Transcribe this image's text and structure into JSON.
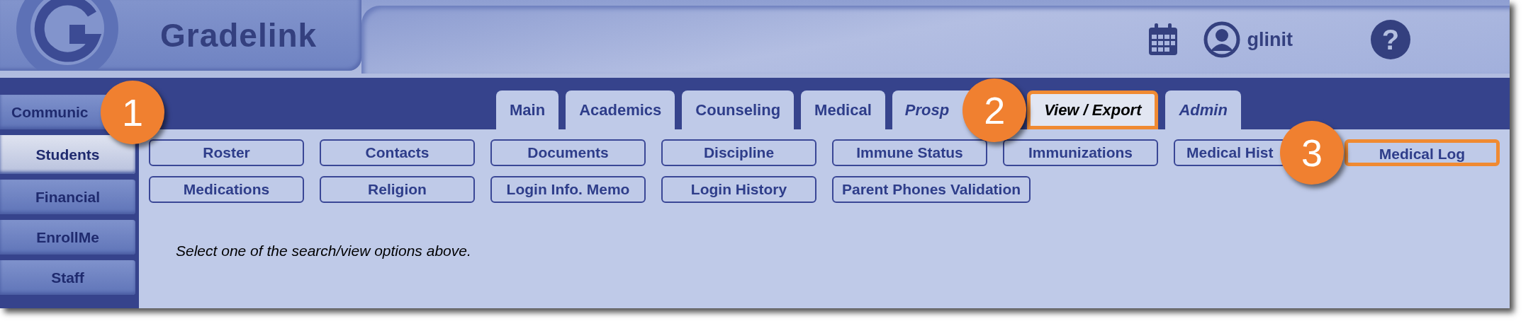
{
  "header": {
    "brand": "Gradelink",
    "username": "glinit",
    "help": "?"
  },
  "sidebar": {
    "items": [
      {
        "label": "Communic",
        "selected": false,
        "cut": true
      },
      {
        "label": "Students",
        "selected": true,
        "cut": false
      },
      {
        "label": "Financial",
        "selected": false,
        "cut": false
      },
      {
        "label": "EnrollMe",
        "selected": false,
        "cut": false
      },
      {
        "label": "Staff",
        "selected": false,
        "cut": false
      }
    ]
  },
  "tabs": [
    {
      "label": "Main",
      "kind": "standard",
      "selected": false,
      "highlighted": false,
      "cut": false
    },
    {
      "label": "Academics",
      "kind": "standard",
      "selected": false,
      "highlighted": false,
      "cut": false
    },
    {
      "label": "Counseling",
      "kind": "standard",
      "selected": false,
      "highlighted": false,
      "cut": false
    },
    {
      "label": "Medical",
      "kind": "standard",
      "selected": false,
      "highlighted": false,
      "cut": false
    },
    {
      "label": "Prosp",
      "kind": "extra",
      "selected": false,
      "highlighted": false,
      "cut": true
    },
    {
      "label": "View / Export",
      "kind": "extra",
      "selected": true,
      "highlighted": true,
      "cut": false
    },
    {
      "label": "Admin",
      "kind": "extra",
      "selected": false,
      "highlighted": false,
      "cut": false
    }
  ],
  "options": [
    {
      "label": "Roster",
      "highlighted": false,
      "cut": false
    },
    {
      "label": "Contacts",
      "highlighted": false,
      "cut": false
    },
    {
      "label": "Documents",
      "highlighted": false,
      "cut": false
    },
    {
      "label": "Discipline",
      "highlighted": false,
      "cut": false
    },
    {
      "label": "Immune Status",
      "highlighted": false,
      "cut": false
    },
    {
      "label": "Immunizations",
      "highlighted": false,
      "cut": false
    },
    {
      "label": "Medical Hist",
      "highlighted": false,
      "cut": true
    },
    {
      "label": "Medical Log",
      "highlighted": true,
      "cut": false
    },
    {
      "label": "Medications",
      "highlighted": false,
      "cut": false
    },
    {
      "label": "Religion",
      "highlighted": false,
      "cut": false
    },
    {
      "label": "Login Info. Memo",
      "highlighted": false,
      "cut": false
    },
    {
      "label": "Login History",
      "highlighted": false,
      "cut": false
    },
    {
      "label": "Parent Phones Validation",
      "highlighted": false,
      "cut": false
    }
  ],
  "message": "Select one of the search/view options above.",
  "callouts": [
    {
      "label": "1"
    },
    {
      "label": "2"
    },
    {
      "label": "3"
    }
  ]
}
